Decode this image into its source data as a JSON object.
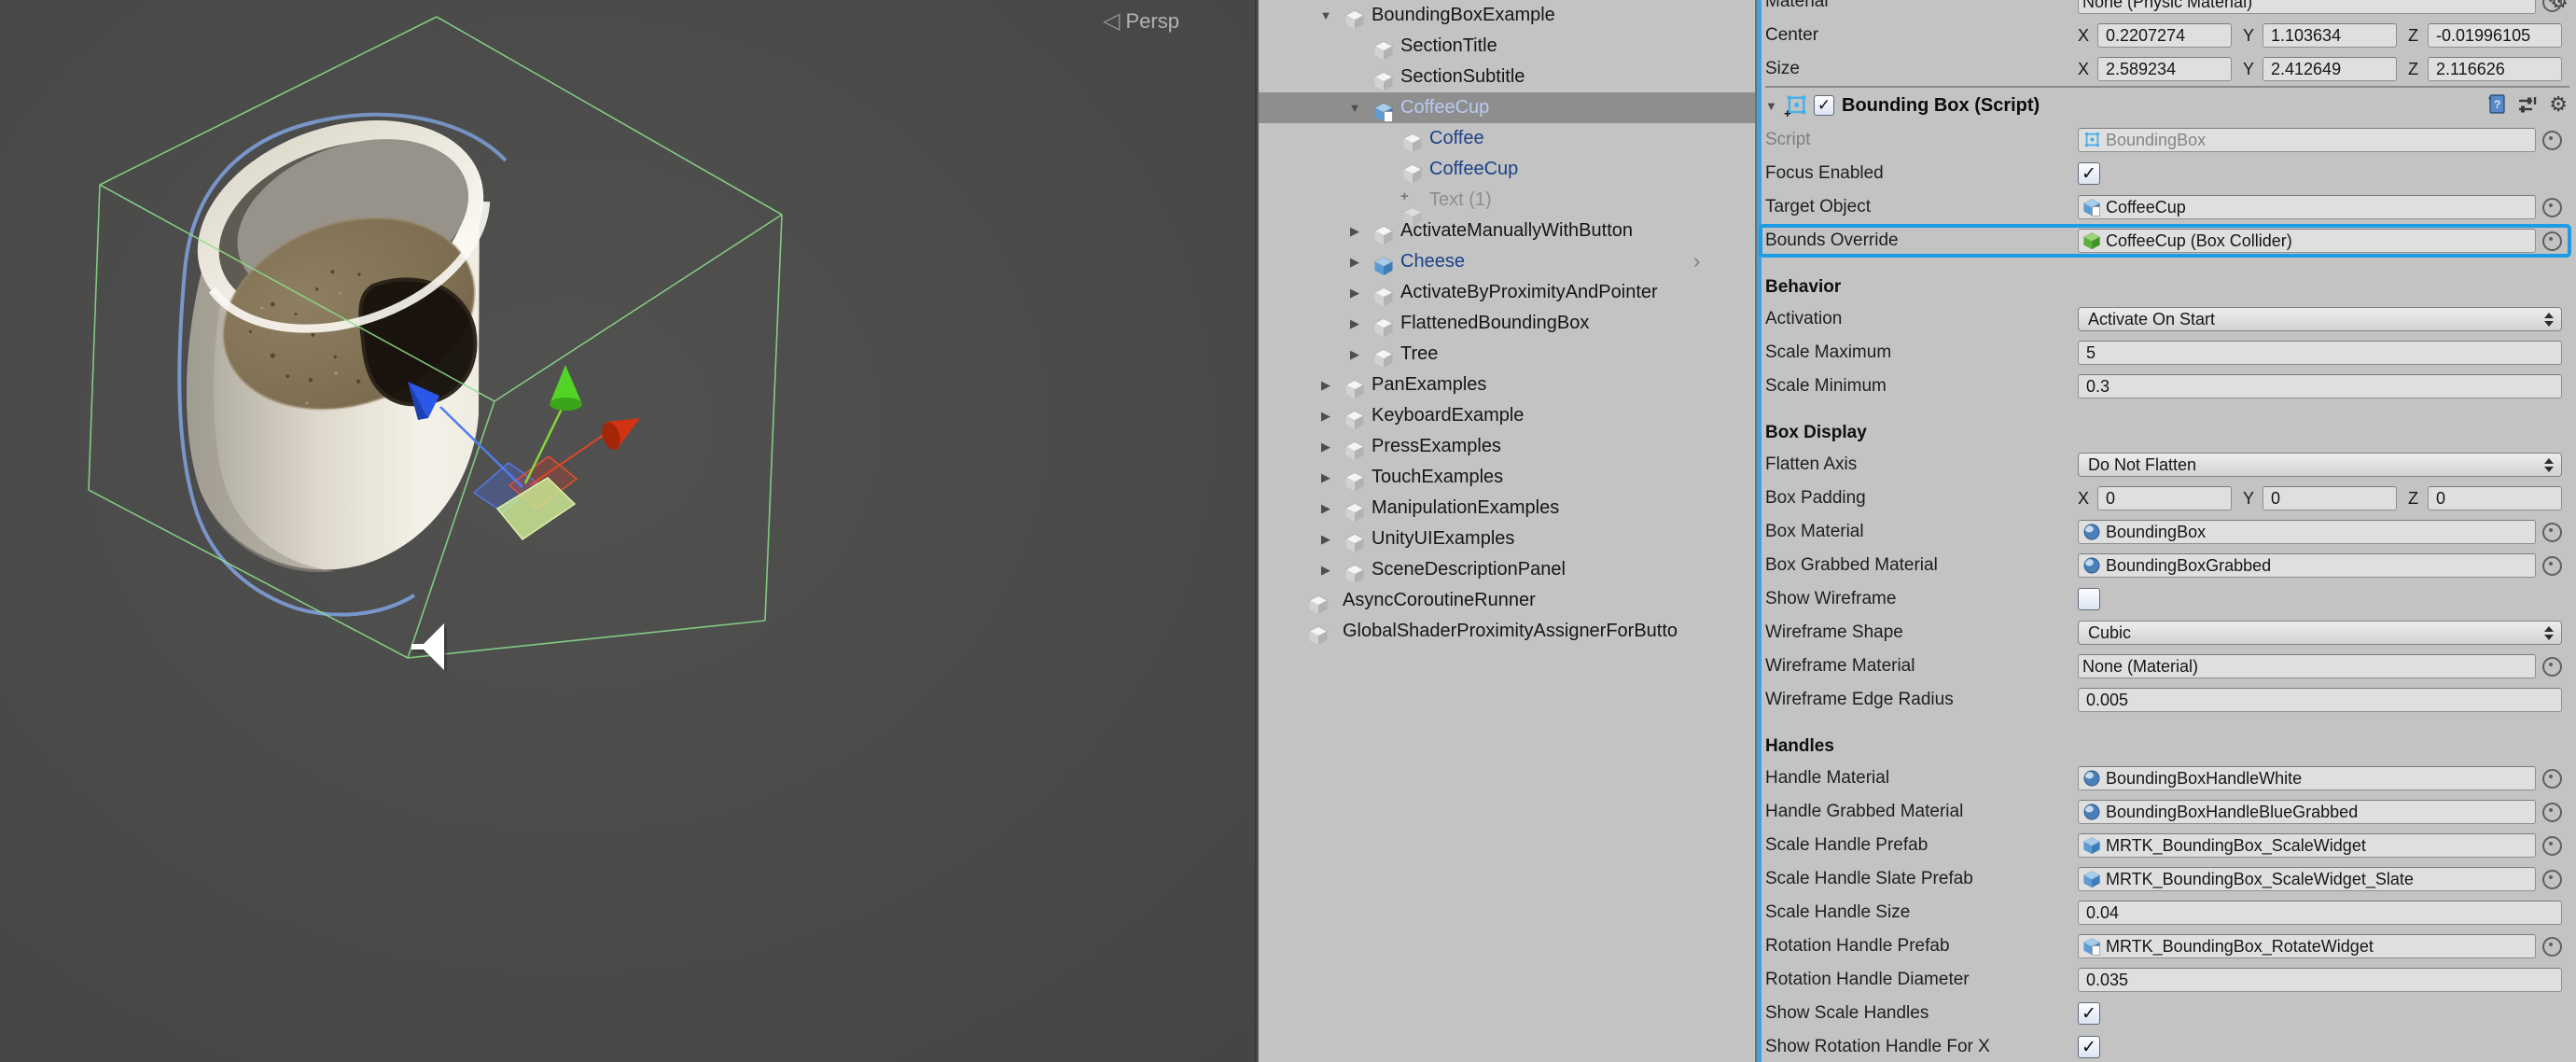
{
  "scene": {
    "view_gizmo_label": "Persp",
    "view_gizmo_arrow": "◁",
    "background_color": "#4a4a4a",
    "wireframe_color": "#8ce08c",
    "selection_outline_color": "#7e9fd8",
    "axis_colors": {
      "x": "#d43214",
      "y": "#52d427",
      "z": "#2a59e8"
    }
  },
  "hierarchy": {
    "selected_item": "CoffeeCup",
    "items": [
      {
        "label": "BoundingBoxExample",
        "level": 0,
        "expand": "expanded",
        "icon": "cube",
        "style": "normal"
      },
      {
        "label": "SectionTitle",
        "level": 1,
        "expand": "none",
        "icon": "cube",
        "style": "normal"
      },
      {
        "label": "SectionSubtitle",
        "level": 1,
        "expand": "none",
        "icon": "cube",
        "style": "normal"
      },
      {
        "label": "CoffeeCup",
        "level": 1,
        "expand": "expanded",
        "icon": "prefab-doc",
        "style": "selected"
      },
      {
        "label": "Coffee",
        "level": 2,
        "expand": "none",
        "icon": "cube",
        "style": "prefab"
      },
      {
        "label": "CoffeeCup",
        "level": 2,
        "expand": "none",
        "icon": "cube",
        "style": "prefab"
      },
      {
        "label": "Text (1)",
        "level": 2,
        "expand": "none",
        "icon": "cube-plus",
        "style": "disabled"
      },
      {
        "label": "ActivateManuallyWithButton",
        "level": 1,
        "expand": "collapsed",
        "icon": "cube",
        "style": "normal"
      },
      {
        "label": "Cheese",
        "level": 1,
        "expand": "collapsed",
        "icon": "prefab",
        "style": "prefab",
        "chevron": "›"
      },
      {
        "label": "ActivateByProximityAndPointer",
        "level": 1,
        "expand": "collapsed",
        "icon": "cube",
        "style": "normal"
      },
      {
        "label": "FlattenedBoundingBox",
        "level": 1,
        "expand": "collapsed",
        "icon": "cube",
        "style": "normal"
      },
      {
        "label": "Tree",
        "level": 1,
        "expand": "collapsed",
        "icon": "cube",
        "style": "normal"
      },
      {
        "label": "PanExamples",
        "level": 0,
        "expand": "collapsed",
        "icon": "cube",
        "style": "normal"
      },
      {
        "label": "KeyboardExample",
        "level": 0,
        "expand": "collapsed",
        "icon": "cube",
        "style": "normal"
      },
      {
        "label": "PressExamples",
        "level": 0,
        "expand": "collapsed",
        "icon": "cube",
        "style": "normal"
      },
      {
        "label": "TouchExamples",
        "level": 0,
        "expand": "collapsed",
        "icon": "cube",
        "style": "normal"
      },
      {
        "label": "ManipulationExamples",
        "level": 0,
        "expand": "collapsed",
        "icon": "cube",
        "style": "normal"
      },
      {
        "label": "UnityUIExamples",
        "level": 0,
        "expand": "collapsed",
        "icon": "cube",
        "style": "normal"
      },
      {
        "label": "SceneDescriptionPanel",
        "level": 0,
        "expand": "collapsed",
        "icon": "cube",
        "style": "normal"
      },
      {
        "label": "AsyncCoroutineRunner",
        "level": 0,
        "expand": "none",
        "icon": "cube",
        "style": "normal"
      },
      {
        "label": "GlobalShaderProximityAssignerForButto",
        "level": 0,
        "expand": "none",
        "icon": "cube",
        "style": "normal"
      }
    ]
  },
  "inspector": {
    "axis_labels": [
      "X",
      "Y",
      "Z"
    ],
    "highlight_color": "#1b9ce4",
    "collider_rows": [
      {
        "type": "object",
        "label": "Material",
        "value": "None (Physic Material)",
        "icon": "none"
      },
      {
        "type": "vector3",
        "label": "Center",
        "x": "0.2207274",
        "y": "1.103634",
        "z": "-0.01996105"
      },
      {
        "type": "vector3",
        "label": "Size",
        "x": "2.589234",
        "y": "2.412649",
        "z": "2.116626"
      }
    ],
    "component": {
      "title": "Bounding Box (Script)",
      "enabled": true
    },
    "rows": [
      {
        "type": "object",
        "label": "Script",
        "value": "BoundingBox",
        "icon": "script",
        "disabled": true
      },
      {
        "type": "checkbox",
        "label": "Focus Enabled",
        "checked": true
      },
      {
        "type": "object",
        "label": "Target Object",
        "value": "CoffeeCup",
        "icon": "prefab-doc"
      },
      {
        "type": "object",
        "label": "Bounds Override",
        "value": "CoffeeCup (Box Collider)",
        "icon": "collider",
        "highlight": true
      },
      {
        "type": "header",
        "label": "Behavior"
      },
      {
        "type": "dropdown",
        "label": "Activation",
        "value": "Activate On Start"
      },
      {
        "type": "text",
        "label": "Scale Maximum",
        "value": "5"
      },
      {
        "type": "text",
        "label": "Scale Minimum",
        "value": "0.3"
      },
      {
        "type": "header",
        "label": "Box Display"
      },
      {
        "type": "dropdown",
        "label": "Flatten Axis",
        "value": "Do Not Flatten"
      },
      {
        "type": "vector3",
        "label": "Box Padding",
        "x": "0",
        "y": "0",
        "z": "0"
      },
      {
        "type": "object",
        "label": "Box Material",
        "value": "BoundingBox",
        "icon": "material"
      },
      {
        "type": "object",
        "label": "Box Grabbed Material",
        "value": "BoundingBoxGrabbed",
        "icon": "material"
      },
      {
        "type": "checkbox",
        "label": "Show Wireframe",
        "checked": false
      },
      {
        "type": "dropdown",
        "label": "Wireframe Shape",
        "value": "Cubic"
      },
      {
        "type": "object",
        "label": "Wireframe Material",
        "value": "None (Material)",
        "icon": "none"
      },
      {
        "type": "text",
        "label": "Wireframe Edge Radius",
        "value": "0.005"
      },
      {
        "type": "header",
        "label": "Handles"
      },
      {
        "type": "object",
        "label": "Handle Material",
        "value": "BoundingBoxHandleWhite",
        "icon": "material"
      },
      {
        "type": "object",
        "label": "Handle Grabbed Material",
        "value": "BoundingBoxHandleBlueGrabbed",
        "icon": "material"
      },
      {
        "type": "object",
        "label": "Scale Handle Prefab",
        "value": "MRTK_BoundingBox_ScaleWidget",
        "icon": "prefab"
      },
      {
        "type": "object",
        "label": "Scale Handle Slate Prefab",
        "value": "MRTK_BoundingBox_ScaleWidget_Slate",
        "icon": "prefab"
      },
      {
        "type": "text",
        "label": "Scale Handle Size",
        "value": "0.04"
      },
      {
        "type": "object",
        "label": "Rotation Handle Prefab",
        "value": "MRTK_BoundingBox_RotateWidget",
        "icon": "prefab-doc"
      },
      {
        "type": "text",
        "label": "Rotation Handle Diameter",
        "value": "0.035"
      },
      {
        "type": "checkbox",
        "label": "Show Scale Handles",
        "checked": true
      },
      {
        "type": "checkbox",
        "label": "Show Rotation Handle For X",
        "checked": true
      }
    ]
  }
}
